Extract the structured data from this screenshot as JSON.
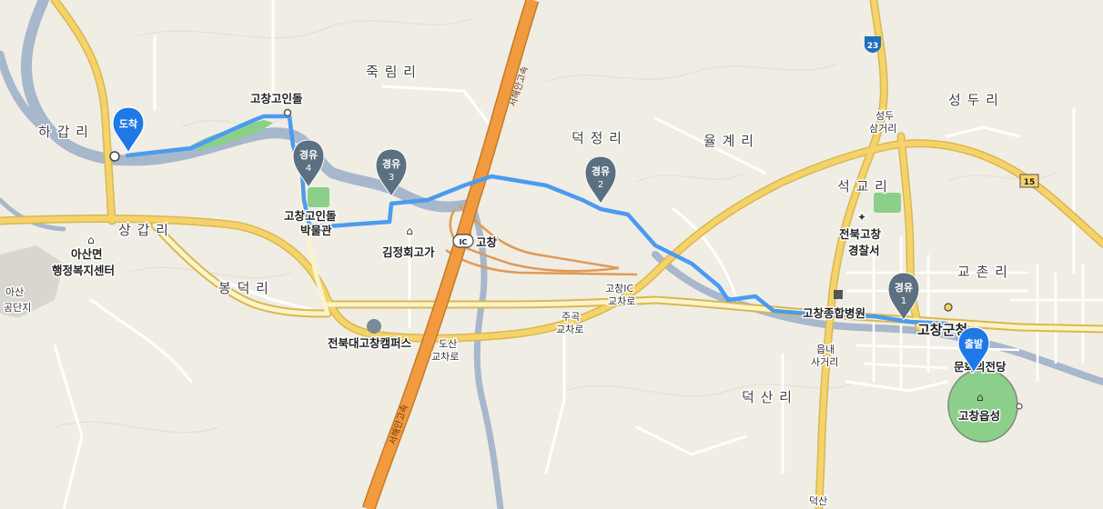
{
  "map": {
    "title": "",
    "colors": {
      "land": "#f0ede5",
      "river": "#a7b7cc",
      "green": "#8ccf8a",
      "road_yellow": "#f6d36a",
      "highway": "#f19a3e",
      "route": "#4b9bf0",
      "marker_blue": "#1e78e6",
      "marker_gray": "#5b7080"
    },
    "places": {
      "jukrim": "죽 림 리",
      "hagap": "하 갑 리",
      "sanggap": "상 갑 리",
      "deokjeong": "덕 정 리",
      "yulgye": "율 계 리",
      "seongdu": "성 두 리",
      "seokgyo": "석 교 리",
      "bongdeok": "봉 덕 리",
      "gyochon": "교 촌 리",
      "deoksan": "덕 산 리",
      "asan_industrial_1": "아산",
      "asan_industrial_2": "공단지"
    },
    "pois": {
      "gochang_goindol": "고창고인돌",
      "museum_1": "고창고인돌",
      "museum_2": "박물관",
      "gimjeonghoe": "김정회고가",
      "asan_office_1": "아산면",
      "asan_office_2": "행정복지센터",
      "jeonbuk_campus": "전북대고창캠퍼스",
      "police_1": "전북고창",
      "police_2": "경찰서",
      "hospital": "고창종합병원",
      "county_office": "고창군청",
      "culture_hall": "문화의전당",
      "eupseong": "고창읍성",
      "ic": "고창",
      "ic_badge": "IC"
    },
    "junctions": {
      "seongdu_1": "성두",
      "seongdu_2": "삼거리",
      "gochang_ic_1": "고창IC",
      "gochang_ic_2": "교차로",
      "jugok_1": "주곡",
      "jugok_2": "교차로",
      "dosan_1": "도산",
      "dosan_2": "교차로",
      "eupnae_1": "읍내",
      "eupnae_2": "사거리",
      "deoksan_bottom": "덕산"
    },
    "roads": {
      "expressway_name": "서해안고속",
      "route_23": "23",
      "route_15": "15"
    },
    "markers": {
      "arrival": "도착",
      "start": "출발",
      "waypoint_label": "경유",
      "wp1": "1",
      "wp2": "2",
      "wp3": "3",
      "wp4": "4"
    }
  }
}
